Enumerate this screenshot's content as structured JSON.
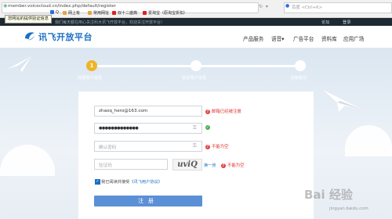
{
  "browser": {
    "url": "member.voicecloud.cn/index.php/default/register",
    "search_placeholder": "百度 <Ctrl+K>",
    "tooltip": "您网站的提供验证信息",
    "bookmarks": [
      "百度",
      "Q",
      "常用网址",
      "双十二盛典",
      "爱淘宝（原淘宝折扣）",
      "网上有"
    ]
  },
  "site": {
    "top_strip_text": "我们每天都在用心关注科大讯飞开放平台，欢迎关注开放平台!",
    "top_links": [
      "论坛",
      "登录"
    ],
    "logo": "讯飞开放平台",
    "nav": [
      "产品服务",
      "语音▾",
      "广告平台",
      "资料库",
      "应用广场"
    ]
  },
  "steps": [
    {
      "number": "1",
      "label": "完善账户信息"
    },
    {
      "number": "",
      "label": "验证账户信息"
    },
    {
      "number": "",
      "label": "注册成功"
    }
  ],
  "form": {
    "email_value": "zhaoq_hero@163.com",
    "email_error": "邮箱已经被注册",
    "password_value": "●●●●●●●●●●●●●",
    "confirm_placeholder": "确认密码",
    "confirm_error": "不能为空",
    "captcha_placeholder": "验证码",
    "captcha_image_text": "uviQ",
    "refresh_link": "换一张",
    "captcha_error": "不能为空",
    "agree_text": "我已阅读并接受",
    "agree_link": "《讯飞用户协议》",
    "register_button": "注册"
  },
  "watermark": {
    "text": "Bai 经验",
    "sub": "jingyan.baidu.com"
  },
  "colors": {
    "accent": "#1a6fc4",
    "step_active": "#f0b42a",
    "button": "#5b8fd6",
    "error": "#d33"
  }
}
